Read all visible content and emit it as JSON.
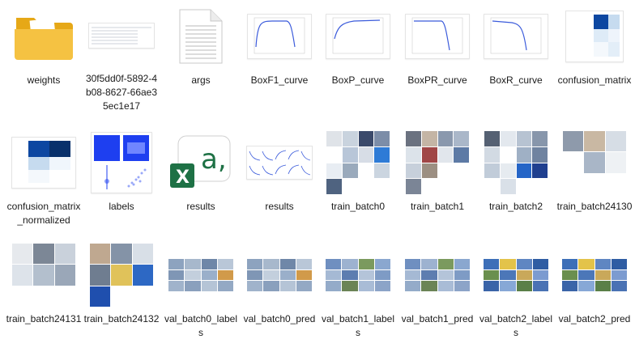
{
  "files": [
    {
      "name": "weights",
      "kind": "folder-icon"
    },
    {
      "name": "30f5dd0f-5892-4b08-8627-66ae35ec1e17",
      "kind": "table-image-icon"
    },
    {
      "name": "args",
      "kind": "text-file-icon"
    },
    {
      "name": "BoxF1_curve",
      "kind": "curve-plot-icon"
    },
    {
      "name": "BoxP_curve",
      "kind": "curve-plot-icon"
    },
    {
      "name": "BoxPR_curve",
      "kind": "curve-plot-icon"
    },
    {
      "name": "BoxR_curve",
      "kind": "curve-plot-icon"
    },
    {
      "name": "confusion_matrix",
      "kind": "confusion-matrix-icon"
    },
    {
      "name": "confusion_matrix_normalized",
      "kind": "confusion-matrix-icon"
    },
    {
      "name": "labels",
      "kind": "labels-plot-icon"
    },
    {
      "name": "results",
      "kind": "excel-file-icon"
    },
    {
      "name": "results",
      "kind": "results-plot-icon"
    },
    {
      "name": "train_batch0",
      "kind": "photo-mosaic-icon"
    },
    {
      "name": "train_batch1",
      "kind": "photo-mosaic-icon"
    },
    {
      "name": "train_batch2",
      "kind": "photo-mosaic-icon"
    },
    {
      "name": "train_batch24130",
      "kind": "photo-mosaic-icon"
    },
    {
      "name": "train_batch24131",
      "kind": "photo-mosaic-icon"
    },
    {
      "name": "train_batch24132",
      "kind": "photo-mosaic-icon"
    },
    {
      "name": "val_batch0_labels",
      "kind": "photo-strip-icon"
    },
    {
      "name": "val_batch0_pred",
      "kind": "photo-strip-icon"
    },
    {
      "name": "val_batch1_labels",
      "kind": "photo-strip-icon"
    },
    {
      "name": "val_batch1_pred",
      "kind": "photo-strip-icon"
    },
    {
      "name": "val_batch2_labels",
      "kind": "photo-strip-icon"
    },
    {
      "name": "val_batch2_pred",
      "kind": "photo-strip-icon"
    }
  ],
  "colors": {
    "folder": "#f5c242",
    "excel": "#1e7145",
    "plot_line": "#3b5bdb",
    "matrix_dark": "#0d47a1",
    "labels_blue": "#1e3ff0"
  }
}
